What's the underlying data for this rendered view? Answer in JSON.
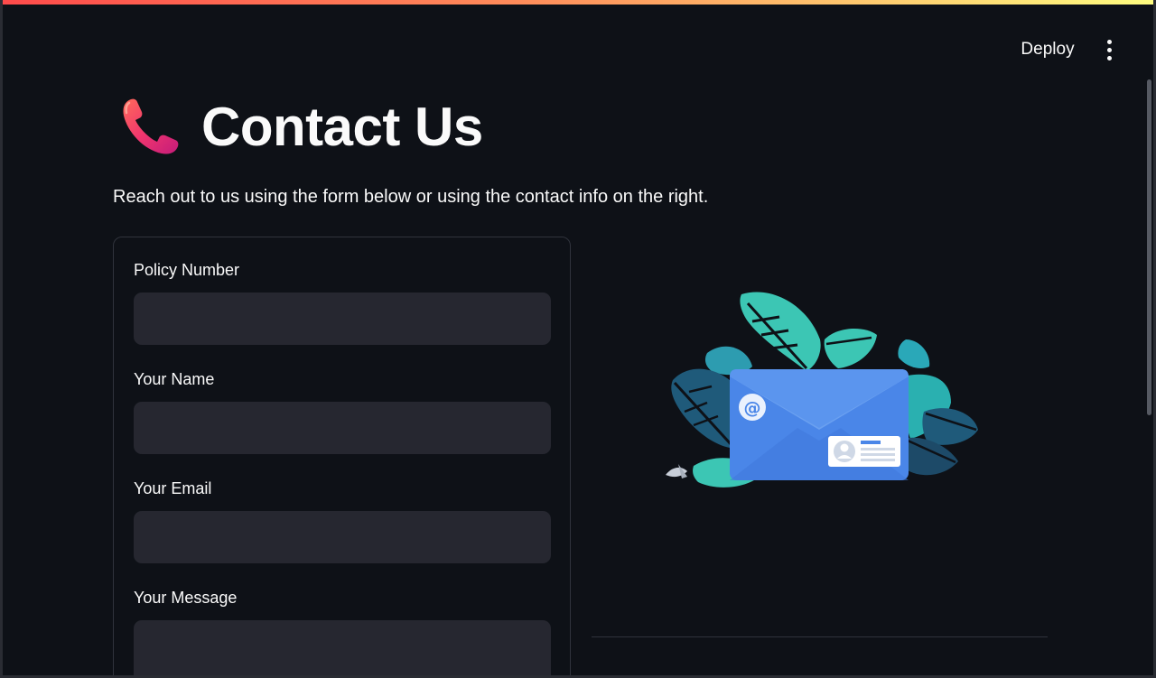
{
  "header": {
    "deploy_label": "Deploy",
    "menu_icon": "more-vertical-icon"
  },
  "main": {
    "title_icon": "telephone-receiver-icon",
    "title": "Contact Us",
    "subtitle": "Reach out to us using the form below or using the contact info on the right."
  },
  "form": {
    "fields": [
      {
        "label": "Policy Number",
        "value": ""
      },
      {
        "label": "Your Name",
        "value": ""
      },
      {
        "label": "Your Email",
        "value": ""
      },
      {
        "label": "Your Message",
        "value": ""
      }
    ]
  },
  "illustration": {
    "icon": "envelope-illustration-icon",
    "at_symbol": "@"
  },
  "colors": {
    "background": "#0e1117",
    "input_background": "#262730",
    "border": "#30333c",
    "text": "#fafafa",
    "envelope_blue": "#4a86e8",
    "leaf_teal": "#3cc6b4",
    "leaf_dark": "#1f5a7a"
  }
}
